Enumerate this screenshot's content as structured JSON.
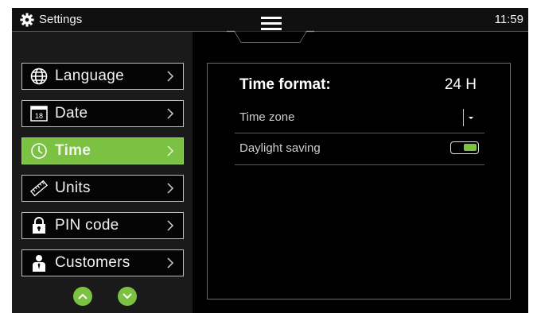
{
  "topbar": {
    "title": "Settings",
    "time": "11:59",
    "icons": {
      "settings": "gear-icon",
      "menu": "hamburger-menu-icon"
    }
  },
  "sidebar": {
    "items": [
      {
        "label": "Language",
        "icon": "globe-icon",
        "active": false
      },
      {
        "label": "Date",
        "icon": "calendar-icon",
        "calendar_day": "18",
        "active": false
      },
      {
        "label": "Time",
        "icon": "clock-icon",
        "active": true
      },
      {
        "label": "Units",
        "icon": "ruler-icon",
        "active": false
      },
      {
        "label": "PIN code",
        "icon": "lock-icon",
        "active": false
      },
      {
        "label": "Customers",
        "icon": "person-icon",
        "active": false
      }
    ],
    "scroll_icons": [
      "chevron-up-icon",
      "chevron-down-icon"
    ]
  },
  "panel": {
    "time_format": {
      "label": "Time format:",
      "value": "24 H"
    },
    "time_zone": {
      "label": "Time zone",
      "control": "dropdown"
    },
    "daylight_saving": {
      "label": "Daylight saving",
      "enabled": true
    }
  },
  "colors": {
    "accent": "#7cc242",
    "background": "#000000",
    "sidebar_bg": "#1a1a1a",
    "border": "#bdbdbd"
  }
}
